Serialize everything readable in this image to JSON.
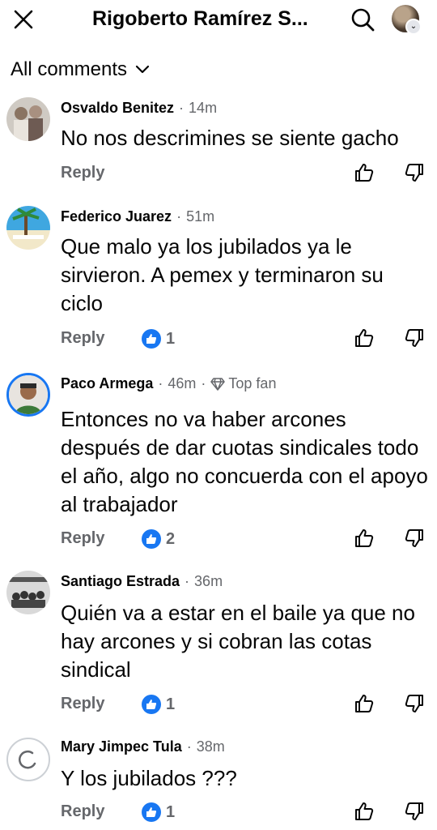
{
  "header": {
    "title": "Rigoberto Ramírez S...",
    "icons": {
      "close": "close-icon",
      "search": "search-icon",
      "profile": "profile-avatar"
    }
  },
  "filter": {
    "label": "All comments",
    "icon": "chevron-down-icon"
  },
  "actions": {
    "reply_label": "Reply"
  },
  "colors": {
    "accent": "#1877f2",
    "secondary_text": "#65676b",
    "primary_text": "#050505"
  },
  "comments": [
    {
      "name": "Osvaldo Benitez",
      "time": "14m",
      "text": "No nos descrimines se siente gacho",
      "reactions": ""
    },
    {
      "name": "Federico Juarez",
      "time": "51m",
      "text": "Que malo ya los jubilados ya le sirvieron. A pemex y terminaron su ciclo",
      "reactions": "1"
    },
    {
      "name": "Paco Armega",
      "time": "46m",
      "badge": "Top fan",
      "text": "Entonces no va haber arcones después de dar cuotas sindicales todo el año, algo no concuerda con el apoyo al trabajador",
      "reactions": "2"
    },
    {
      "name": "Santiago Estrada",
      "time": "36m",
      "text": "Quién va a estar en el  baile  ya que no hay arcones y si cobran las cotas sindical",
      "reactions": "1"
    },
    {
      "name": "Mary Jimpec Tula",
      "time": "38m",
      "text": "Y los jubilados ???",
      "reactions": "1"
    }
  ]
}
